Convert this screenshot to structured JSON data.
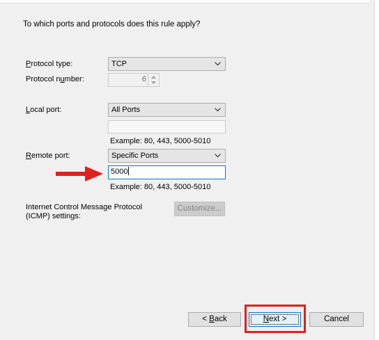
{
  "question": "To which ports and protocols does this rule apply?",
  "protocol_type": {
    "label_mnemonic": "P",
    "label_rest": "rotocol type:",
    "value": "TCP"
  },
  "protocol_number": {
    "label_pre": "Protocol n",
    "label_mnemonic": "u",
    "label_post": "mber:",
    "value": "6"
  },
  "local_port": {
    "label_mnemonic": "L",
    "label_rest": "ocal port:",
    "value": "All Ports",
    "text": "",
    "example": "Example: 80, 443, 5000-5010"
  },
  "remote_port": {
    "label_mnemonic": "R",
    "label_rest": "emote port:",
    "value": "Specific Ports",
    "text": "5000",
    "example": "Example: 80, 443, 5000-5010"
  },
  "icmp": {
    "label_line1": "Internet Control Message Protocol",
    "label_line2": "(ICMP) settings:",
    "button_label": "Customize..."
  },
  "buttons": {
    "back_prefix": "< ",
    "back_mnemonic": "B",
    "back_rest": "ack",
    "next_mnemonic": "N",
    "next_rest": "ext >",
    "cancel": "Cancel"
  },
  "colors": {
    "annotation_red": "#e0201b",
    "focus_blue": "#0078d7"
  },
  "icons": {
    "dropdown": "chevron-down-icon",
    "spin_up": "triangle-up-icon",
    "spin_down": "triangle-down-icon",
    "annotation_arrow": "red-arrow-right-icon"
  }
}
